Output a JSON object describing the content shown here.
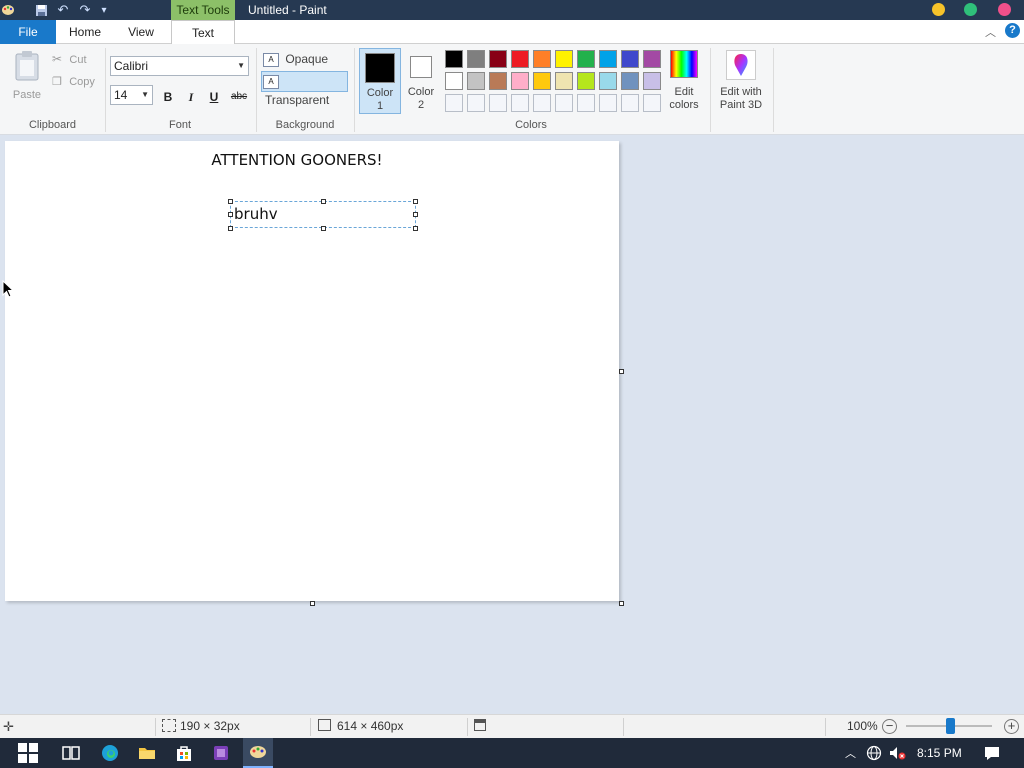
{
  "window": {
    "title": "Untitled - Paint",
    "context_tab": "Text Tools"
  },
  "tabs": [
    "File",
    "Home",
    "View",
    "Text"
  ],
  "clipboard": {
    "paste": "Paste",
    "cut": "Cut",
    "copy": "Copy",
    "group": "Clipboard"
  },
  "font": {
    "family": "Calibri",
    "size": "14",
    "bold": "B",
    "italic": "I",
    "underline": "U",
    "strike": "abc",
    "group": "Font"
  },
  "background": {
    "opaque": "Opaque",
    "transparent": "Transparent",
    "group": "Background"
  },
  "colors": {
    "color1_l1": "Color",
    "color1_l2": "1",
    "color2_l1": "Color",
    "color2_l2": "2",
    "group": "Colors",
    "edit_l1": "Edit",
    "edit_l2": "colors",
    "paint3d_l1": "Edit with",
    "paint3d_l2": "Paint 3D",
    "color1_value": "#000000",
    "color2_value": "#ffffff",
    "palette_row1": [
      "#000000",
      "#7f7f7f",
      "#880015",
      "#ed1c24",
      "#ff7f27",
      "#fff200",
      "#22b14c",
      "#00a2e8",
      "#3f48cc",
      "#a349a4"
    ],
    "palette_row2": [
      "#ffffff",
      "#c3c3c3",
      "#b97a57",
      "#ffaec9",
      "#ffc90e",
      "#efe4b0",
      "#b5e61d",
      "#99d9ea",
      "#7092be",
      "#c8bfe7"
    ]
  },
  "canvas": {
    "heading": "ATTENTION GOONERS!",
    "textbox": "bruhv"
  },
  "status": {
    "selection": "190 × 32px",
    "canvas_size": "614 × 460px",
    "zoom": "100%"
  },
  "taskbar": {
    "time": "8:15 PM"
  }
}
